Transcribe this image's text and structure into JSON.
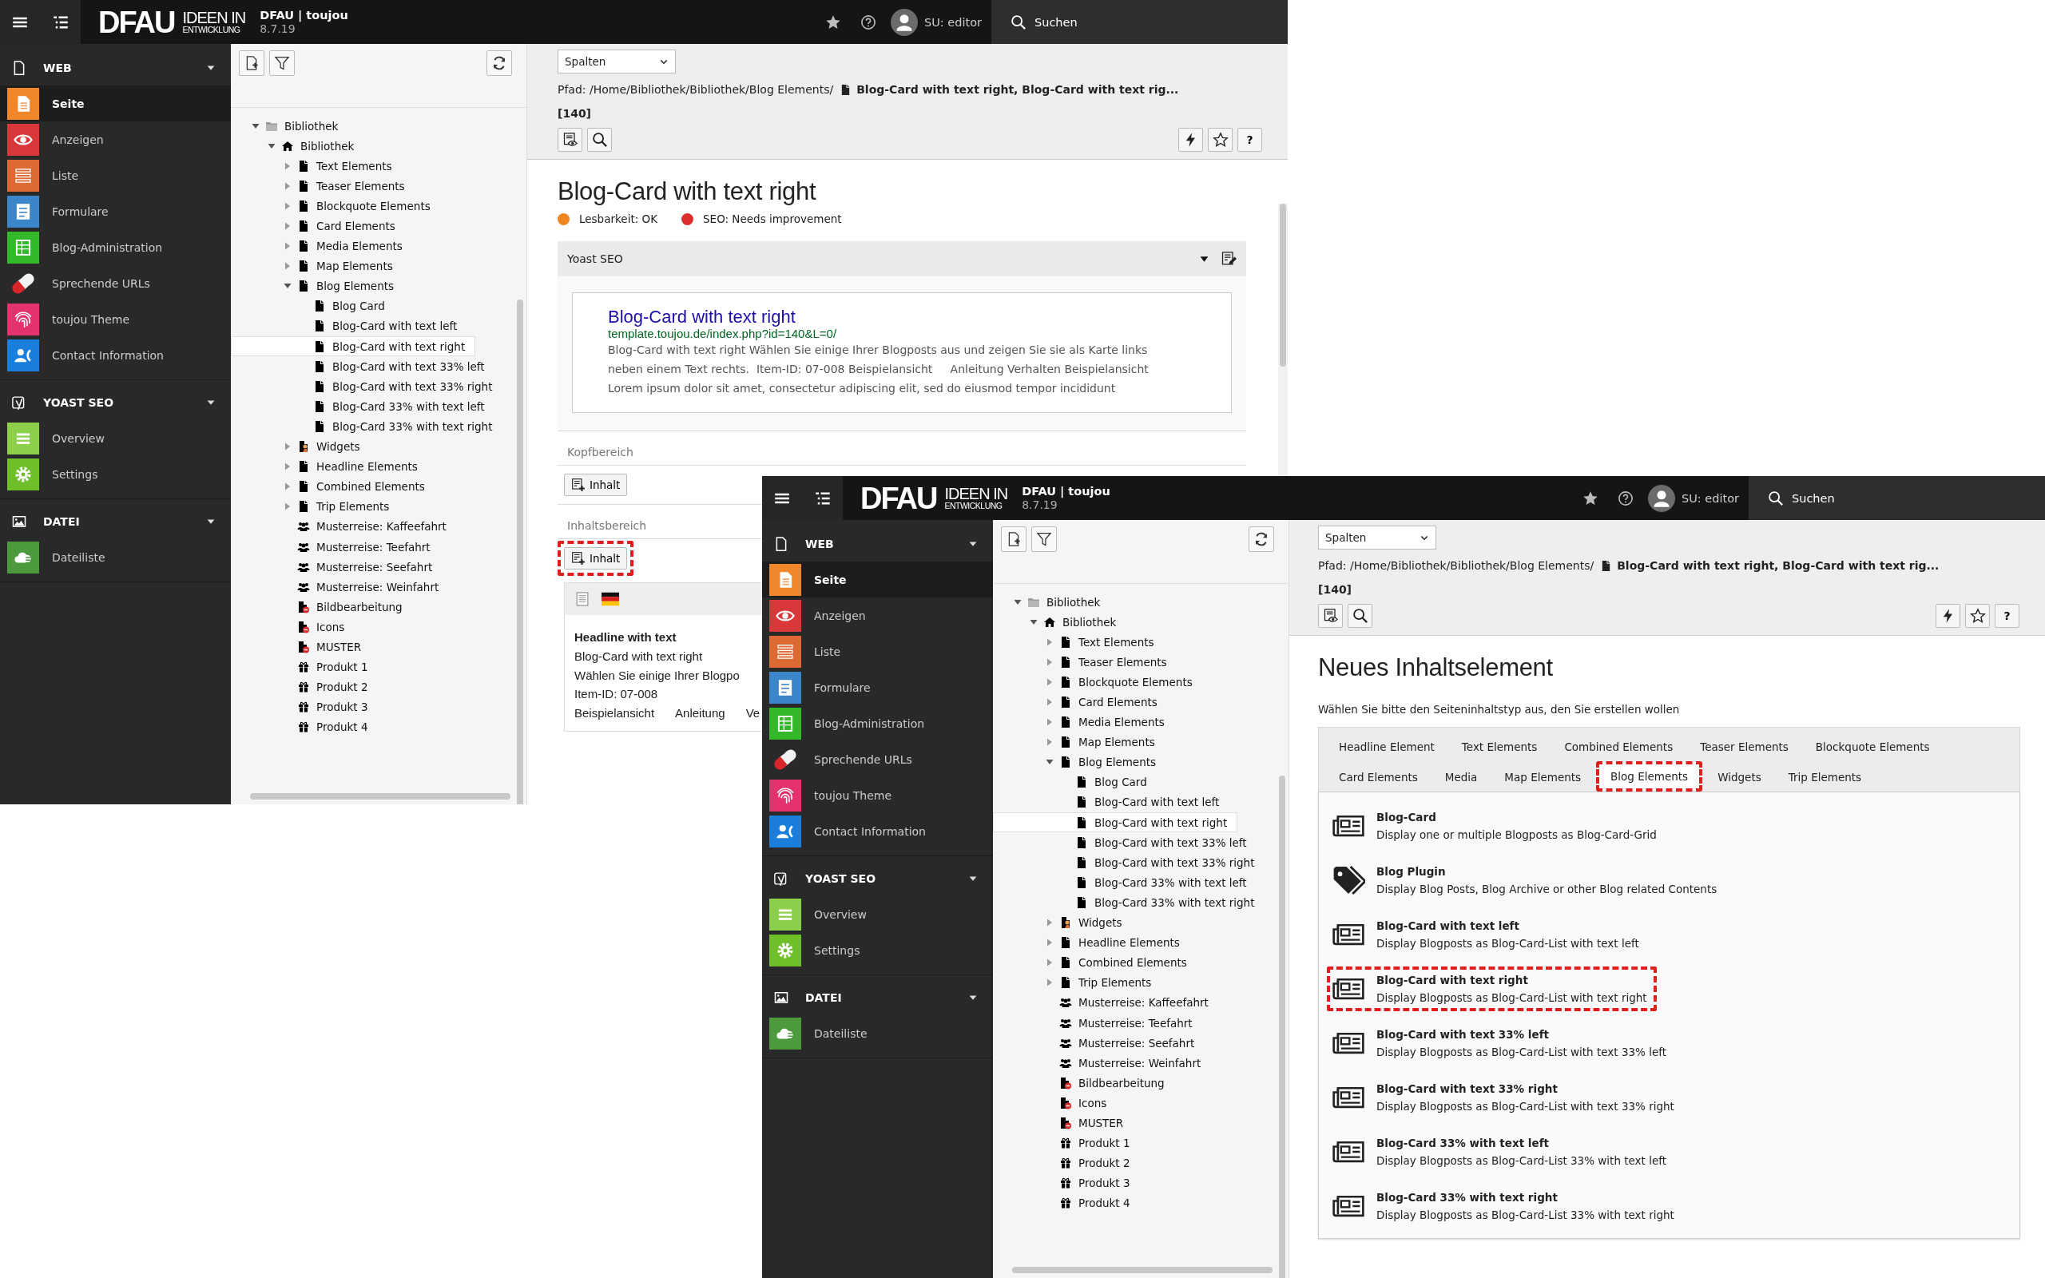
{
  "windows": [
    {
      "topbar": {
        "logo_main": "DFAU",
        "logo_top": "IDEEN IN",
        "logo_bottom": "ENTWICKLUNG",
        "site": "DFAU | toujou",
        "version": "8.7.19",
        "user": "SU: editor",
        "search": "Suchen"
      },
      "sidebar": [
        {
          "label": "WEB",
          "kind": "page-outline",
          "items": [
            {
              "label": "Seite",
              "kind": "page",
              "color": "#f0872a",
              "selected": true
            },
            {
              "label": "Anzeigen",
              "kind": "eye",
              "color": "#d9373a",
              "selected": false
            },
            {
              "label": "Liste",
              "kind": "list",
              "color": "#dd6a35",
              "selected": false
            },
            {
              "label": "Formulare",
              "kind": "form",
              "color": "#3a86c8",
              "selected": false
            },
            {
              "label": "Blog-Administration",
              "kind": "table",
              "color": "#33b82a",
              "selected": false
            },
            {
              "label": "Sprechende URLs",
              "kind": "pill",
              "selected": false
            },
            {
              "label": "toujou Theme",
              "kind": "fingerprint",
              "color": "#e3326c",
              "selected": false
            },
            {
              "label": "Contact Information",
              "kind": "contact",
              "color": "#1a7fdc",
              "selected": false
            }
          ]
        },
        {
          "label": "YOAST SEO",
          "kind": "yoast",
          "items": [
            {
              "label": "Overview",
              "kind": "bars",
              "color": "#8bcf4a",
              "selected": false
            },
            {
              "label": "Settings",
              "kind": "gear",
              "color": "#6fbf2a",
              "selected": false
            }
          ]
        },
        {
          "label": "DATEI",
          "kind": "image",
          "items": [
            {
              "label": "Dateiliste",
              "kind": "cloud",
              "color": "#4d9a3e",
              "selected": false
            }
          ]
        }
      ],
      "tree": [
        {
          "label": "Bibliothek",
          "kind": "folder",
          "expanded": true,
          "selected": false,
          "children": [
            {
              "label": "Bibliothek",
              "kind": "home",
              "expanded": true,
              "selected": false,
              "children": [
                {
                  "label": "Text Elements",
                  "kind": "doc",
                  "expanded": false,
                  "selected": false
                },
                {
                  "label": "Teaser Elements",
                  "kind": "doc",
                  "expanded": false,
                  "selected": false
                },
                {
                  "label": "Blockquote Elements",
                  "kind": "doc",
                  "expanded": false,
                  "selected": false
                },
                {
                  "label": "Card Elements",
                  "kind": "doc",
                  "expanded": false,
                  "selected": false
                },
                {
                  "label": "Media Elements",
                  "kind": "doc",
                  "expanded": false,
                  "selected": false
                },
                {
                  "label": "Map Elements",
                  "kind": "doc",
                  "expanded": false,
                  "selected": false
                },
                {
                  "label": "Blog Elements",
                  "kind": "doc",
                  "expanded": true,
                  "selected": false,
                  "children": [
                    {
                      "label": "Blog Card",
                      "kind": "doc",
                      "selected": false
                    },
                    {
                      "label": "Blog-Card with text left",
                      "kind": "doc",
                      "selected": false
                    },
                    {
                      "label": "Blog-Card with text right",
                      "kind": "doc",
                      "selected": true
                    },
                    {
                      "label": "Blog-Card with text 33% left",
                      "kind": "doc",
                      "selected": false
                    },
                    {
                      "label": "Blog-Card with text 33% right",
                      "kind": "doc",
                      "selected": false
                    },
                    {
                      "label": "Blog-Card 33% with text left",
                      "kind": "doc",
                      "selected": false
                    },
                    {
                      "label": "Blog-Card 33% with text right",
                      "kind": "doc",
                      "selected": false
                    }
                  ]
                },
                {
                  "label": "Widgets",
                  "kind": "widget",
                  "expanded": false,
                  "selected": false
                },
                {
                  "label": "Headline Elements",
                  "kind": "doc",
                  "expanded": false,
                  "selected": false
                },
                {
                  "label": "Combined Elements",
                  "kind": "doc",
                  "expanded": false,
                  "selected": false
                },
                {
                  "label": "Trip Elements",
                  "kind": "doc",
                  "expanded": false,
                  "selected": false
                },
                {
                  "label": "Musterreise: Kaffeefahrt",
                  "kind": "group",
                  "selected": false
                },
                {
                  "label": "Musterreise: Teefahrt",
                  "kind": "group",
                  "selected": false
                },
                {
                  "label": "Musterreise: Seefahrt",
                  "kind": "group",
                  "selected": false
                },
                {
                  "label": "Musterreise: Weinfahrt",
                  "kind": "group",
                  "selected": false
                },
                {
                  "label": "Bildbearbeitung",
                  "kind": "restricted",
                  "selected": false
                },
                {
                  "label": "Icons",
                  "kind": "restricted",
                  "selected": false
                },
                {
                  "label": "MUSTER",
                  "kind": "restricted",
                  "selected": false
                },
                {
                  "label": "Produkt 1",
                  "kind": "gift",
                  "selected": false
                },
                {
                  "label": "Produkt 2",
                  "kind": "gift",
                  "selected": false
                },
                {
                  "label": "Produkt 3",
                  "kind": "gift",
                  "selected": false
                },
                {
                  "label": "Produkt 4",
                  "kind": "gift",
                  "selected": false
                }
              ]
            }
          ]
        }
      ],
      "docheader": {
        "select": "Spalten",
        "path": "Pfad: /Home/Bibliothek/Bibliothek/Blog Elements/",
        "page": "Blog-Card with text right, Blog-Card with text rig...",
        "id": "[140]",
        "help": "?"
      },
      "content": {
        "kind": "page-layout",
        "title": "Blog-Card with text right",
        "statuses": [
          {
            "label": "Lesbarkeit: OK",
            "color": "#f0841e"
          },
          {
            "label": "SEO: Needs improvement",
            "color": "#dc2e2e"
          }
        ],
        "yoast": {
          "title": "Yoast SEO",
          "expanded": true,
          "snippet_title": "Blog-Card with text right",
          "snippet_url": "template.toujou.de/index.php?id=140&L=0/",
          "snippet_text": "Blog-Card with text right Wählen Sie einige Ihrer Blogposts aus und zeigen Sie sie als Karte links neben einem Text rechts.  Item-ID: 07-008 Beispielansicht     Anleitung Verhalten Beispielansicht Lorem ipsum dolor sit amet, consectetur adipiscing elit, sed do eiusmod tempor incididunt"
        },
        "areas": [
          {
            "label": "Kopfbereich",
            "button": "Inhalt",
            "highlighted": false
          },
          {
            "label": "Inhaltsbereich",
            "button": "Inhalt",
            "highlighted": true,
            "cards": [
              {
                "headline": "Headline with text",
                "lines": [
                  "Blog-Card with text right",
                  "Wählen Sie einige Ihrer Blogpo",
                  "Item-ID: 07-008"
                ],
                "links": [
                  "Beispielansicht",
                  "Anleitung",
                  "Ve"
                ]
              }
            ]
          }
        ]
      }
    },
    {
      "topbar": {
        "logo_main": "DFAU",
        "logo_top": "IDEEN IN",
        "logo_bottom": "ENTWICKLUNG",
        "site": "DFAU | toujou",
        "version": "8.7.19",
        "user": "SU: editor",
        "search": "Suchen"
      },
      "sidebar": [
        {
          "label": "WEB",
          "kind": "page-outline",
          "items": [
            {
              "label": "Seite",
              "kind": "page",
              "color": "#f0872a",
              "selected": true
            },
            {
              "label": "Anzeigen",
              "kind": "eye",
              "color": "#d9373a",
              "selected": false
            },
            {
              "label": "Liste",
              "kind": "list",
              "color": "#dd6a35",
              "selected": false
            },
            {
              "label": "Formulare",
              "kind": "form",
              "color": "#3a86c8",
              "selected": false
            },
            {
              "label": "Blog-Administration",
              "kind": "table",
              "color": "#33b82a",
              "selected": false
            },
            {
              "label": "Sprechende URLs",
              "kind": "pill",
              "selected": false
            },
            {
              "label": "toujou Theme",
              "kind": "fingerprint",
              "color": "#e3326c",
              "selected": false
            },
            {
              "label": "Contact Information",
              "kind": "contact",
              "color": "#1a7fdc",
              "selected": false
            }
          ]
        },
        {
          "label": "YOAST SEO",
          "kind": "yoast",
          "items": [
            {
              "label": "Overview",
              "kind": "bars",
              "color": "#8bcf4a",
              "selected": false
            },
            {
              "label": "Settings",
              "kind": "gear",
              "color": "#6fbf2a",
              "selected": false
            }
          ]
        },
        {
          "label": "DATEI",
          "kind": "image",
          "items": [
            {
              "label": "Dateiliste",
              "kind": "cloud",
              "color": "#4d9a3e",
              "selected": false
            }
          ]
        }
      ],
      "tree": [
        {
          "label": "Bibliothek",
          "kind": "folder",
          "expanded": true,
          "selected": false,
          "children": [
            {
              "label": "Bibliothek",
              "kind": "home",
              "expanded": true,
              "selected": false,
              "children": [
                {
                  "label": "Text Elements",
                  "kind": "doc",
                  "expanded": false,
                  "selected": false
                },
                {
                  "label": "Teaser Elements",
                  "kind": "doc",
                  "expanded": false,
                  "selected": false
                },
                {
                  "label": "Blockquote Elements",
                  "kind": "doc",
                  "expanded": false,
                  "selected": false
                },
                {
                  "label": "Card Elements",
                  "kind": "doc",
                  "expanded": false,
                  "selected": false
                },
                {
                  "label": "Media Elements",
                  "kind": "doc",
                  "expanded": false,
                  "selected": false
                },
                {
                  "label": "Map Elements",
                  "kind": "doc",
                  "expanded": false,
                  "selected": false
                },
                {
                  "label": "Blog Elements",
                  "kind": "doc",
                  "expanded": true,
                  "selected": false,
                  "children": [
                    {
                      "label": "Blog Card",
                      "kind": "doc",
                      "selected": false
                    },
                    {
                      "label": "Blog-Card with text left",
                      "kind": "doc",
                      "selected": false
                    },
                    {
                      "label": "Blog-Card with text right",
                      "kind": "doc",
                      "selected": true
                    },
                    {
                      "label": "Blog-Card with text 33% left",
                      "kind": "doc",
                      "selected": false
                    },
                    {
                      "label": "Blog-Card with text 33% right",
                      "kind": "doc",
                      "selected": false
                    },
                    {
                      "label": "Blog-Card 33% with text left",
                      "kind": "doc",
                      "selected": false
                    },
                    {
                      "label": "Blog-Card 33% with text right",
                      "kind": "doc",
                      "selected": false
                    }
                  ]
                },
                {
                  "label": "Widgets",
                  "kind": "widget",
                  "expanded": false,
                  "selected": false
                },
                {
                  "label": "Headline Elements",
                  "kind": "doc",
                  "expanded": false,
                  "selected": false
                },
                {
                  "label": "Combined Elements",
                  "kind": "doc",
                  "expanded": false,
                  "selected": false
                },
                {
                  "label": "Trip Elements",
                  "kind": "doc",
                  "expanded": false,
                  "selected": false
                },
                {
                  "label": "Musterreise: Kaffeefahrt",
                  "kind": "group",
                  "selected": false
                },
                {
                  "label": "Musterreise: Teefahrt",
                  "kind": "group",
                  "selected": false
                },
                {
                  "label": "Musterreise: Seefahrt",
                  "kind": "group",
                  "selected": false
                },
                {
                  "label": "Musterreise: Weinfahrt",
                  "kind": "group",
                  "selected": false
                },
                {
                  "label": "Bildbearbeitung",
                  "kind": "restricted",
                  "selected": false
                },
                {
                  "label": "Icons",
                  "kind": "restricted",
                  "selected": false
                },
                {
                  "label": "MUSTER",
                  "kind": "restricted",
                  "selected": false
                },
                {
                  "label": "Produkt 1",
                  "kind": "gift",
                  "selected": false
                },
                {
                  "label": "Produkt 2",
                  "kind": "gift",
                  "selected": false
                },
                {
                  "label": "Produkt 3",
                  "kind": "gift",
                  "selected": false
                },
                {
                  "label": "Produkt 4",
                  "kind": "gift",
                  "selected": false
                }
              ]
            }
          ]
        }
      ],
      "docheader": {
        "select": "Spalten",
        "path": "Pfad: /Home/Bibliothek/Bibliothek/Blog Elements/",
        "page": "Blog-Card with text right, Blog-Card with text rig...",
        "id": "[140]",
        "help": "?"
      },
      "content": {
        "kind": "new-element",
        "title": "Neues Inhaltselement",
        "intro": "Wählen Sie bitte den Seiteninhaltstyp aus, den Sie erstellen wollen",
        "tab_rows": [
          {
            "tabs": [
              {
                "label": "Headline Element",
                "selected": false,
                "highlighted": false
              },
              {
                "label": "Text Elements",
                "selected": false,
                "highlighted": false
              },
              {
                "label": "Combined Elements",
                "selected": false,
                "highlighted": false
              },
              {
                "label": "Teaser Elements",
                "selected": false,
                "highlighted": false
              },
              {
                "label": "Blockquote Elements",
                "selected": false,
                "highlighted": false
              }
            ]
          },
          {
            "tabs": [
              {
                "label": "Card Elements",
                "selected": false,
                "highlighted": false
              },
              {
                "label": "Media",
                "selected": false,
                "highlighted": false
              },
              {
                "label": "Map Elements",
                "selected": false,
                "highlighted": false
              },
              {
                "label": "Blog Elements",
                "selected": true,
                "highlighted": true
              },
              {
                "label": "Widgets",
                "selected": false,
                "highlighted": false
              },
              {
                "label": "Trip Elements",
                "selected": false,
                "highlighted": false
              }
            ]
          }
        ],
        "elements": [
          {
            "kind": "newspaper",
            "title": "Blog-Card",
            "description": "Display one or multiple Blogposts as Blog-Card-Grid",
            "highlighted": false
          },
          {
            "kind": "tag",
            "title": "Blog Plugin",
            "description": "Display Blog Posts, Blog Archive or other Blog related Contents",
            "highlighted": false
          },
          {
            "kind": "newspaper",
            "title": "Blog-Card with text left",
            "description": "Display Blogposts as Blog-Card-List with text left",
            "highlighted": false
          },
          {
            "kind": "newspaper",
            "title": "Blog-Card with text right",
            "description": "Display Blogposts as Blog-Card-List with text right",
            "highlighted": true
          },
          {
            "kind": "newspaper",
            "title": "Blog-Card with text 33% left",
            "description": "Display Blogposts as Blog-Card-List with text 33% left",
            "highlighted": false
          },
          {
            "kind": "newspaper",
            "title": "Blog-Card with text 33% right",
            "description": "Display Blogposts as Blog-Card-List with text 33% right",
            "highlighted": false
          },
          {
            "kind": "newspaper",
            "title": "Blog-Card 33% with text left",
            "description": "Display Blogposts as Blog-Card-List 33% with text left",
            "highlighted": false
          },
          {
            "kind": "newspaper",
            "title": "Blog-Card 33% with text right",
            "description": "Display Blogposts as Blog-Card-List 33% with text right",
            "highlighted": false
          }
        ]
      }
    }
  ]
}
